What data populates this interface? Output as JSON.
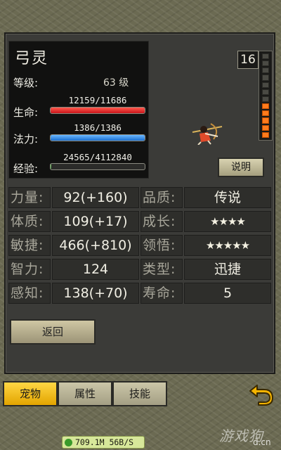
{
  "pet": {
    "name": "弓灵",
    "level_label": "等级:",
    "level_value": "63 级",
    "hp_label": "生命:",
    "hp_text": "12159/11686",
    "hp_ratio": 1.0,
    "mp_label": "法力:",
    "mp_text": "1386/1386",
    "mp_ratio": 1.0,
    "exp_label": "经验:",
    "exp_text": "24565/4112840",
    "exp_ratio": 0.006
  },
  "loyalty": {
    "value": "16",
    "cells_on": 5,
    "cells_total": 12
  },
  "explain_label": "说明",
  "attributes": {
    "rows": [
      {
        "left_label": "力量:",
        "left_value": "92(+160)",
        "right_label": "品质:",
        "right_value": "传说"
      },
      {
        "left_label": "体质:",
        "left_value": "109(+17)",
        "right_label": "成长:",
        "right_value": "★★★★",
        "right_stars": 3.5
      },
      {
        "left_label": "敏捷:",
        "left_value": "466(+810)",
        "right_label": "领悟:",
        "right_value": "★★★★★",
        "right_stars": 4.5
      },
      {
        "left_label": "智力:",
        "left_value": "124",
        "right_label": "类型:",
        "right_value": "迅捷"
      },
      {
        "left_label": "感知:",
        "left_value": "138(+70)",
        "right_label": "寿命:",
        "right_value": "5"
      }
    ]
  },
  "return_label": "返回",
  "tabs": [
    {
      "label": "宠物",
      "active": true
    },
    {
      "label": "属性",
      "active": false
    },
    {
      "label": "技能",
      "active": false
    }
  ],
  "status_bar": {
    "text": "709.1M 56B/S"
  },
  "watermark": {
    "text": "游戏狗",
    "domain": "d.cn"
  },
  "colors": {
    "hp": "#d0201f",
    "mp": "#2a7ed8",
    "tab_active": "#f2c12a",
    "gauge_on": "#ff7b1c"
  },
  "icons": {
    "back": "return-arrow-icon",
    "status": "network-icon"
  }
}
